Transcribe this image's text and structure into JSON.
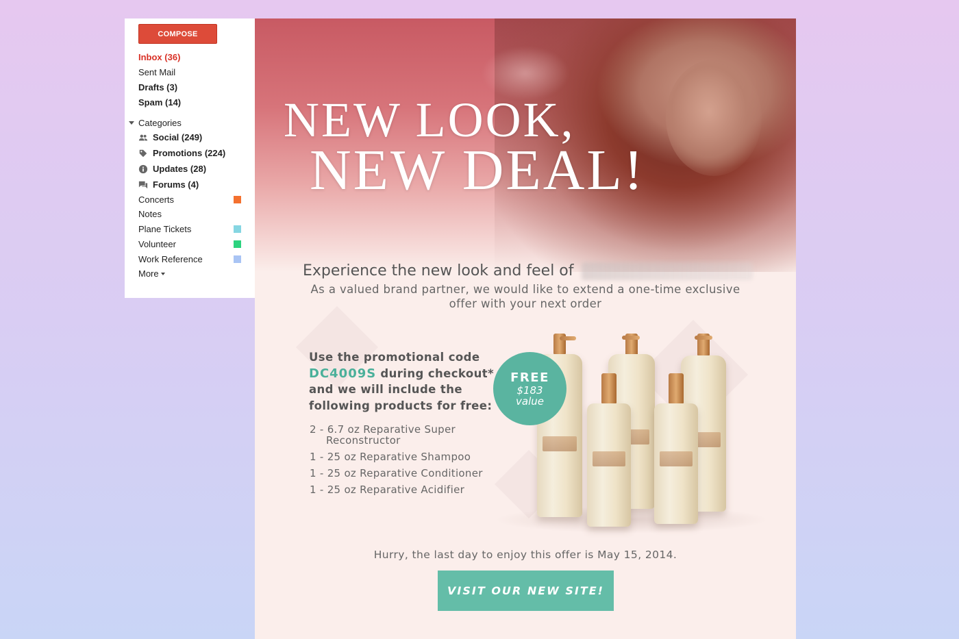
{
  "sidebar": {
    "compose_label": "COMPOSE",
    "inbox": "Inbox (36)",
    "sent": "Sent Mail",
    "drafts": "Drafts (3)",
    "spam": "Spam (14)",
    "categories_label": "Categories",
    "categories": [
      {
        "label": "Social (249)",
        "icon": "people-icon"
      },
      {
        "label": "Promotions (224)",
        "icon": "tag-icon"
      },
      {
        "label": "Updates (28)",
        "icon": "info-icon"
      },
      {
        "label": "Forums (4)",
        "icon": "chat-icon"
      }
    ],
    "labels": [
      {
        "label": "Concerts",
        "color": "#f4712f"
      },
      {
        "label": "Notes",
        "color": ""
      },
      {
        "label": "Plane Tickets",
        "color": "#86d6e2"
      },
      {
        "label": "Volunteer",
        "color": "#2dd37f"
      },
      {
        "label": "Work Reference",
        "color": "#a9c4f4"
      }
    ],
    "more_label": "More"
  },
  "email": {
    "headline_line1": "NEW LOOK,",
    "headline_line2": "NEW DEAL!",
    "experience_title": "Experience the new look and feel of",
    "subtitle_line1": "As a valued brand partner, we would like to extend a one-time exclusive",
    "subtitle_line2": "offer with your next order",
    "promo_line1": "Use the promotional code",
    "promo_code": "DC4009S",
    "promo_line2_rest": " during checkout*",
    "promo_line3": "and we will include the",
    "promo_line4": "following products for free:",
    "products": [
      {
        "line1": "2 - 6.7 oz Reparative Super",
        "line2": "Reconstructor"
      },
      {
        "line1": "1 - 25 oz Reparative Shampoo",
        "line2": ""
      },
      {
        "line1": "1 - 25 oz Reparative Conditioner",
        "line2": ""
      },
      {
        "line1": "1 - 25 oz Reparative Acidifier",
        "line2": ""
      }
    ],
    "badge_free": "FREE",
    "badge_value_amount": "$183",
    "badge_value_label": "value",
    "hurry_text": "Hurry, the last day to enjoy this offer is May 15, 2014.",
    "cta_label": "VISIT OUR NEW SITE!",
    "accent_color": "#5ab4a0"
  }
}
